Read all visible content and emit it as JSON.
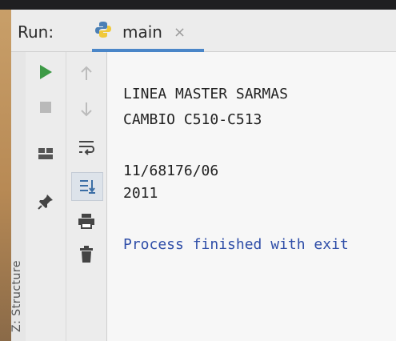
{
  "run_panel": {
    "label": "Run:",
    "tab": {
      "label": "main",
      "close": "×",
      "icon": "python-icon"
    }
  },
  "left_toolbar": {
    "icons": [
      "run-icon",
      "stop-icon",
      "layout-icon",
      "pin-icon"
    ]
  },
  "middle_toolbar": {
    "icons": [
      "arrow-up-icon",
      "arrow-down-icon",
      "soft-wrap-icon",
      "scroll-to-end-icon",
      "print-icon",
      "trash-icon"
    ]
  },
  "sidebar": {
    "structure_label": "Z: Structure"
  },
  "console": {
    "lines": [
      "LINEA MASTER SARMAS",
      "CAMBIO C510-C513",
      "",
      "11/68176/06",
      "2011",
      "",
      "Process finished with exit"
    ]
  },
  "colors": {
    "run_green": "#3d9a46",
    "accent_blue": "#4a86c8",
    "exit_text": "#2f4ea8"
  }
}
